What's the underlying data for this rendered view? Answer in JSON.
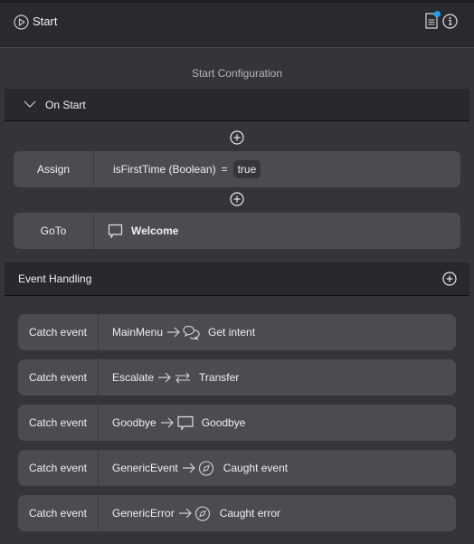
{
  "header": {
    "title": "Start",
    "play_icon": "play-circle-icon",
    "doc_icon": "document-icon",
    "notification_color": "#1aa0f5",
    "info_icon": "info-icon"
  },
  "config_title": "Start Configuration",
  "on_start": {
    "label": "On Start",
    "assign": {
      "key": "Assign",
      "variable": "isFirstTime (Boolean)",
      "operator": "=",
      "value": "true"
    },
    "goto": {
      "key": "GoTo",
      "target": "Welcome",
      "icon": "message-icon"
    }
  },
  "event_handling": {
    "label": "Event Handling",
    "events": [
      {
        "key": "Catch event",
        "event": "MainMenu",
        "icon": "chat-bubbles-icon",
        "target": "Get intent"
      },
      {
        "key": "Catch event",
        "event": "Escalate",
        "icon": "transfer-icon",
        "target": "Transfer"
      },
      {
        "key": "Catch event",
        "event": "Goodbye",
        "icon": "message-icon",
        "target": "Goodbye"
      },
      {
        "key": "Catch event",
        "event": "GenericEvent",
        "icon": "compass-icon",
        "target": "Caught event"
      },
      {
        "key": "Catch event",
        "event": "GenericError",
        "icon": "compass-icon",
        "target": "Caught error"
      }
    ]
  }
}
